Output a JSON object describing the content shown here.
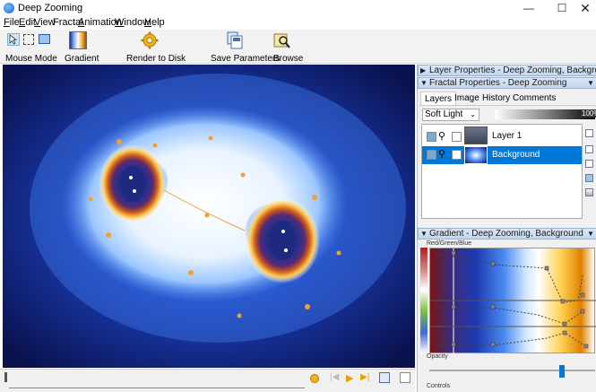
{
  "window": {
    "title": "Deep Zooming"
  },
  "menu": [
    {
      "label": "File",
      "key": "F",
      "rest": "ile"
    },
    {
      "label": "Edit",
      "key": "E",
      "rest": "dit"
    },
    {
      "label": "View",
      "key": "V",
      "rest": "iew"
    },
    {
      "label": "Fractal",
      "key": "",
      "rest": "Fractal"
    },
    {
      "label": "Animation",
      "key": "A",
      "rest": "nimation"
    },
    {
      "label": "Window",
      "key": "W",
      "rest": "indow"
    },
    {
      "label": "Help",
      "key": "H",
      "rest": "elp"
    }
  ],
  "toolbar": {
    "mouse_mode": "Mouse Mode",
    "gradient": "Gradient",
    "render": "Render to Disk",
    "save_params": "Save Parameters",
    "browse": "Browse"
  },
  "panels": {
    "layer_props": "Layer Properties - Deep Zooming, Background",
    "fractal_props": "Fractal Properties - Deep Zooming",
    "gradient_panel": "Gradient - Deep Zooming, Background"
  },
  "tabs": [
    "Layers",
    "Image",
    "History",
    "Comments"
  ],
  "layers": {
    "blend_mode": "Soft Light",
    "opacity": "100%",
    "items": [
      {
        "name": "Layer 1",
        "selected": false
      },
      {
        "name": "Background",
        "selected": true
      }
    ]
  },
  "gradient": {
    "channel_label": "Red/Green/Blue",
    "opacity_label": "Opacity",
    "controls_label": "Controls"
  },
  "colors": {
    "selection": "#0078d7",
    "panel_header": "#c4d6ec"
  }
}
